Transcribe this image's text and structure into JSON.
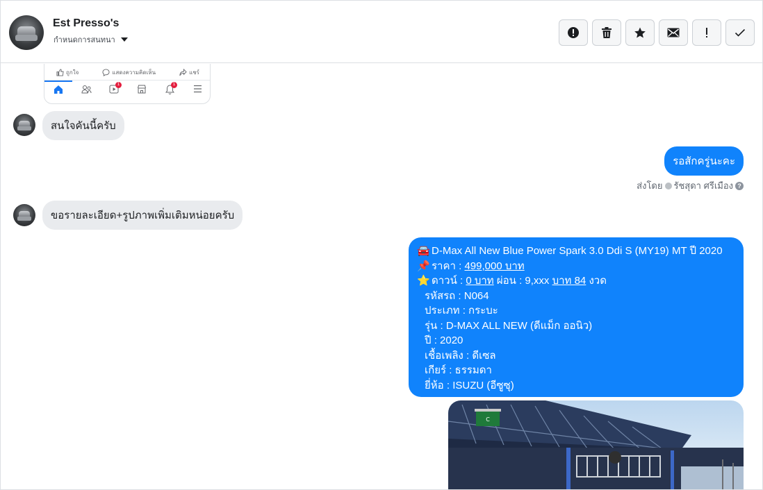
{
  "header": {
    "name": "Est Presso's",
    "subtitle": "กำหนดการสนทนา"
  },
  "toolbar": {
    "buttons": [
      {
        "name": "spam",
        "icon": "alert-circle-icon"
      },
      {
        "name": "delete",
        "icon": "trash-icon"
      },
      {
        "name": "star",
        "icon": "star-icon"
      },
      {
        "name": "unread",
        "icon": "envelope-icon"
      },
      {
        "name": "follow-up",
        "icon": "exclamation-icon"
      },
      {
        "name": "done",
        "icon": "checkmark-icon"
      }
    ]
  },
  "fbcard": {
    "like": "ถูกใจ",
    "comment": "แสดงความคิดเห็น",
    "share": "แชร์",
    "badge_video": "1",
    "badge_notif": "1"
  },
  "messages": {
    "m1": "สนใจคันนี้ครับ",
    "m2": "รอสักครู่นะคะ",
    "sentby_label": "ส่งโดย",
    "sentby_name": "รัชสุดา ศรีเมือง",
    "m3": "ขอรายละเอียด+รูปภาพเพิ่มเติมหน่อยครับ"
  },
  "listing": {
    "title_emoji": "🚘",
    "title": "D-Max All New Blue Power Spark 3.0 Ddi S (MY19) MT ปี 2020",
    "price_emoji": "📌",
    "price_label": "ราคา : ",
    "price_value": "499,000 บาท",
    "down_emoji": "⭐",
    "down_label": "ดาวน์ : ",
    "down_value": "0 บาท",
    "installment_label": " ผ่อน : 9,xxx ",
    "installment_link": "บาท 84",
    "installment_suffix": " งวด",
    "code": "รหัสรถ : N064",
    "type": "ประเภท : กระบะ",
    "model": "รุ่น : D-MAX ALL NEW (ดีแม็ก ออนิว)",
    "year": "ปี : 2020",
    "fuel": "เชื้อเพลิง : ดีเซล",
    "gear": "เกียร์ : ธรรมดา",
    "brand": "ยี่ห้อ : ISUZU (อีซูซุ)"
  },
  "photo": {
    "sign_text": "C"
  }
}
